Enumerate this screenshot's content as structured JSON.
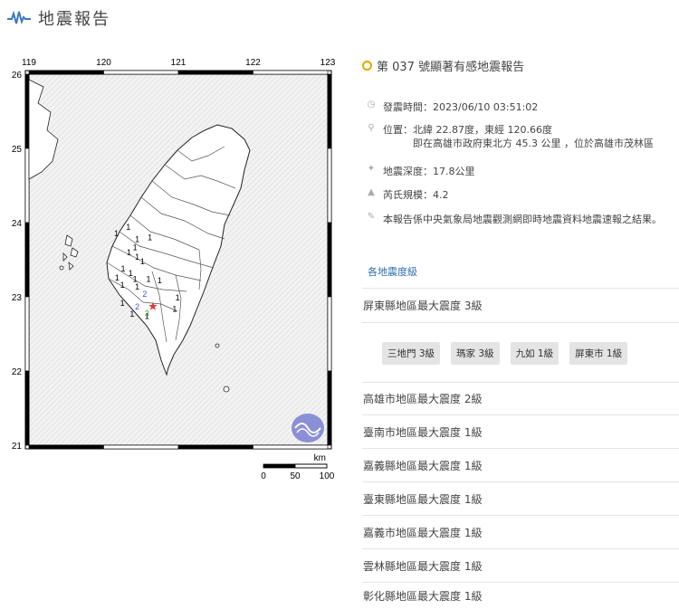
{
  "header": {
    "title": "地震報告",
    "icon": "seismograph-icon"
  },
  "map": {
    "lon_ticks": [
      "119",
      "120",
      "121",
      "122",
      "123"
    ],
    "lat_ticks": [
      "26",
      "25",
      "24",
      "23",
      "22",
      "21"
    ],
    "scale": {
      "unit": "km",
      "labels": [
        "0",
        "50",
        "100"
      ]
    },
    "epicenter": {
      "lat": 22.87,
      "lon": 120.66,
      "color": "#e53935"
    },
    "intensity_marks": [
      {
        "text": "1",
        "lon": 120.33,
        "lat": 23.9
      },
      {
        "text": "1",
        "lon": 120.17,
        "lat": 23.82
      },
      {
        "text": "1",
        "lon": 120.45,
        "lat": 23.74
      },
      {
        "text": "1",
        "lon": 120.62,
        "lat": 23.76
      },
      {
        "text": "1",
        "lon": 120.42,
        "lat": 23.63
      },
      {
        "text": "1",
        "lon": 120.34,
        "lat": 23.56
      },
      {
        "text": "1",
        "lon": 120.45,
        "lat": 23.5
      },
      {
        "text": "1",
        "lon": 120.52,
        "lat": 23.44
      },
      {
        "text": "1",
        "lon": 120.26,
        "lat": 23.34
      },
      {
        "text": "1",
        "lon": 120.36,
        "lat": 23.28
      },
      {
        "text": "1",
        "lon": 120.18,
        "lat": 23.22
      },
      {
        "text": "1",
        "lon": 120.42,
        "lat": 23.2
      },
      {
        "text": "1",
        "lon": 120.25,
        "lat": 23.12
      },
      {
        "text": "1",
        "lon": 120.45,
        "lat": 23.1
      },
      {
        "text": "1",
        "lon": 120.6,
        "lat": 23.2
      },
      {
        "text": "1",
        "lon": 120.75,
        "lat": 23.18
      },
      {
        "text": "1",
        "lon": 120.99,
        "lat": 22.95
      },
      {
        "text": "1",
        "lon": 120.95,
        "lat": 22.8
      },
      {
        "text": "1",
        "lon": 120.38,
        "lat": 22.73
      },
      {
        "text": "1",
        "lon": 120.25,
        "lat": 22.88
      },
      {
        "text": "1",
        "lon": 120.58,
        "lat": 22.7
      },
      {
        "text": "2",
        "lon": 120.55,
        "lat": 23.0,
        "color": "#3b4fd1"
      },
      {
        "text": "2",
        "lon": 120.45,
        "lat": 22.83,
        "color": "#3b4fd1"
      },
      {
        "text": "3",
        "lon": 120.58,
        "lat": 22.74,
        "color": "#2e9a2e"
      }
    ]
  },
  "report": {
    "title": "第 037 號顯著有感地震報告",
    "time": "發震時間：2023/06/10 03:51:02",
    "location_line1": "位置：北緯 22.87度，東經 120.66度",
    "location_line2": "即在高雄市政府東北方 45.3 公里 ，位於高雄市茂林區",
    "depth": "地震深度：17.8公里",
    "magnitude": "芮氏規模：4.2",
    "note": "本報告係中央氣象局地震觀測網即時地震資料地震速報之結果。"
  },
  "intensity_section": {
    "title": "各地震度級",
    "pingtung": "屏東縣地區最大震度 3級",
    "stations": [
      "三地門 3級",
      "瑪家 3級",
      "九如 1級",
      "屏東市 1級"
    ],
    "others": [
      "高雄市地區最大震度 2級",
      "臺南市地區最大震度 1級",
      "嘉義縣地區最大震度 1級",
      "臺東縣地區最大震度 1級",
      "嘉義市地區最大震度 1級",
      "雲林縣地區最大震度 1級",
      "彰化縣地區最大震度 1級"
    ]
  },
  "colors": {
    "accent_blue": "#2f6fb0",
    "dot_yellow": "#e0a800",
    "chip_bg": "#e4e4e4"
  }
}
